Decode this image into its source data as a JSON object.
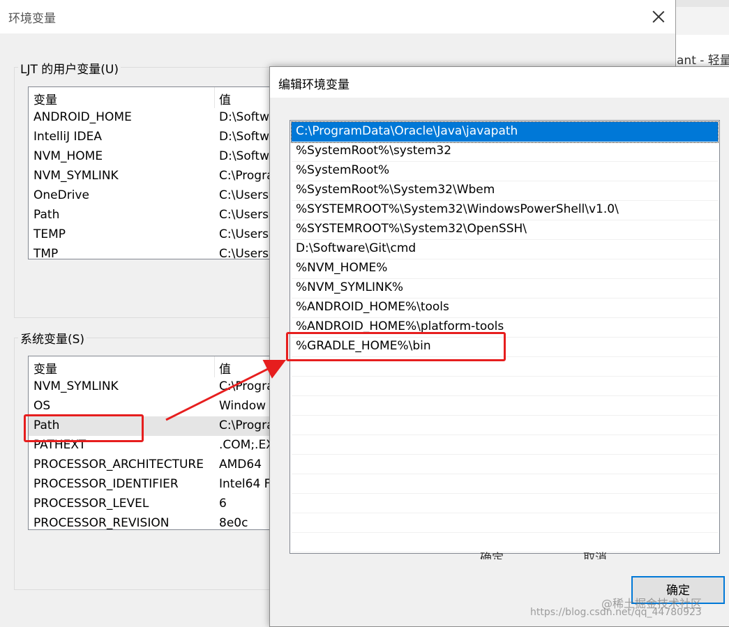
{
  "background_window": {
    "partial_title": "ant - 轻量"
  },
  "env_dialog": {
    "title": "环境变量",
    "user_group_label": "LJT 的用户变量(U)",
    "system_group_label": "系统变量(S)",
    "col_variable": "变量",
    "col_value": "值",
    "user_vars": [
      {
        "name": "ANDROID_HOME",
        "value": "D:\\Softw"
      },
      {
        "name": "IntelliJ IDEA",
        "value": "D:\\Softw"
      },
      {
        "name": "NVM_HOME",
        "value": "D:\\Softw"
      },
      {
        "name": "NVM_SYMLINK",
        "value": "C:\\Progra"
      },
      {
        "name": "OneDrive",
        "value": "C:\\Users"
      },
      {
        "name": "Path",
        "value": "C:\\Users"
      },
      {
        "name": "TEMP",
        "value": "C:\\Users"
      },
      {
        "name": "TMP",
        "value": "C:\\Users"
      }
    ],
    "system_vars": [
      {
        "name": "NVM_SYMLINK",
        "value": "C:\\Progra"
      },
      {
        "name": "OS",
        "value": "Window"
      },
      {
        "name": "Path",
        "value": "C:\\Progra"
      },
      {
        "name": "PATHEXT",
        "value": ".COM;.EX"
      },
      {
        "name": "PROCESSOR_ARCHITECTURE",
        "value": "AMD64"
      },
      {
        "name": "PROCESSOR_IDENTIFIER",
        "value": "Intel64 F"
      },
      {
        "name": "PROCESSOR_LEVEL",
        "value": "6"
      },
      {
        "name": "PROCESSOR_REVISION",
        "value": "8e0c"
      }
    ],
    "partial_buttons": [
      "确定",
      "取消"
    ]
  },
  "edit_dialog": {
    "title": "编辑环境变量",
    "path_entries": [
      "C:\\ProgramData\\Oracle\\Java\\javapath",
      "%SystemRoot%\\system32",
      "%SystemRoot%",
      "%SystemRoot%\\System32\\Wbem",
      "%SYSTEMROOT%\\System32\\WindowsPowerShell\\v1.0\\",
      "%SYSTEMROOT%\\System32\\OpenSSH\\",
      "D:\\Software\\Git\\cmd",
      "%NVM_HOME%",
      "%NVM_SYMLINK%",
      "%ANDROID_HOME%\\tools",
      "%ANDROID_HOME%\\platform-tools",
      "%GRADLE_HOME%\\bin"
    ],
    "selected_index": 0,
    "ok_label": "确定"
  },
  "watermark": {
    "line1": "@稀土掘金技术社区",
    "line2": "https://blog.csdn.net/qq_44780923"
  },
  "colors": {
    "selection": "#0078d7",
    "highlight": "#e61e1e"
  }
}
